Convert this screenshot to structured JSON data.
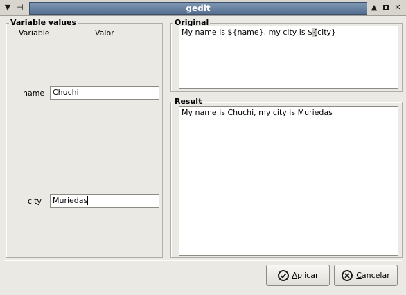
{
  "window": {
    "title": "gedit",
    "icons": {
      "menu": "window-menu-icon",
      "pin": "pin-icon",
      "shade": "shade-icon",
      "maximize": "maximize-icon",
      "close": "close-icon"
    }
  },
  "variables_panel": {
    "title": "Variable values",
    "col_variable": "Variable",
    "col_value": "Valor",
    "rows": [
      {
        "label": "name",
        "value": "Chuchi"
      },
      {
        "label": "city",
        "value": "Muriedas"
      }
    ]
  },
  "original_panel": {
    "title": "Original",
    "text_before": "My name is ${name}, my city is $",
    "text_selected": "{",
    "text_after": "city}"
  },
  "result_panel": {
    "title": "Result",
    "text": "My name is Chuchi, my city is Muriedas"
  },
  "buttons": {
    "apply": {
      "mnemonic": "A",
      "rest": "plicar",
      "icon": "check-circle-icon"
    },
    "cancel": {
      "mnemonic": "C",
      "rest": "ancelar",
      "icon": "x-circle-icon"
    }
  }
}
